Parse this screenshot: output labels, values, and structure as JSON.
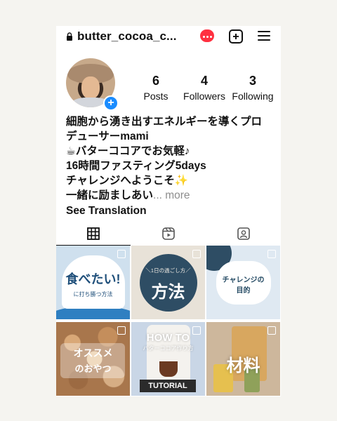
{
  "header": {
    "username": "butter_cocoa_c...",
    "icons": [
      "lock-icon",
      "threads-badge-icon",
      "new-post-icon",
      "menu-icon"
    ],
    "notif_color": "#ff3040"
  },
  "profile": {
    "stats": [
      {
        "num": "6",
        "label": "Posts"
      },
      {
        "num": "4",
        "label": "Followers"
      },
      {
        "num": "3",
        "label": "Following"
      }
    ],
    "bio_lines": [
      "細胞から湧き出すエネルギーを導くプロ",
      "デューサーmami",
      "☕バターココアでお気軽♪",
      "16時間ファスティング5days",
      "チャレンジへようこそ✨",
      "一緒に励ましあい"
    ],
    "more": "... more",
    "see_translation": "See Translation",
    "add_color": "#1a8cff"
  },
  "tabs": [
    "grid-icon",
    "reels-icon",
    "tagged-icon"
  ],
  "posts": [
    {
      "line1": "食べたい!",
      "line2": "に打ち勝つ方法"
    },
    {
      "line1": "＼1日の過ごし方／",
      "line2": "方法"
    },
    {
      "line1": "チャレンジの",
      "line2": "目的"
    },
    {
      "line1": "オススメ",
      "line2": "のおやつ"
    },
    {
      "line1": "HOW TO",
      "line2": "バターココア作り方",
      "line3": "TUTORIAL"
    },
    {
      "line1": "材料"
    }
  ]
}
